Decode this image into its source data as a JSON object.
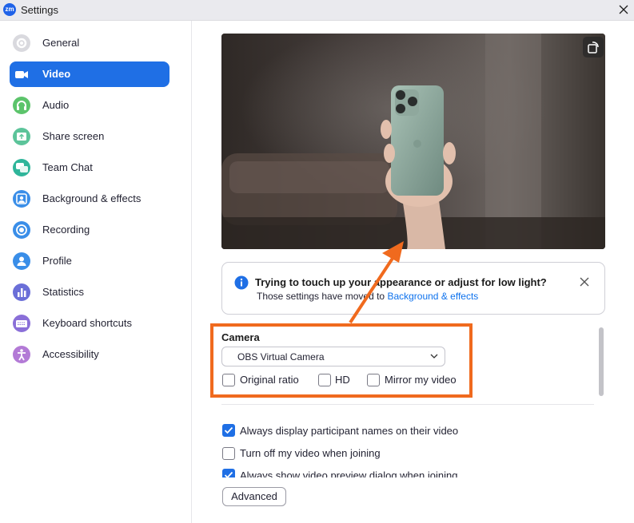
{
  "window": {
    "title": "Settings",
    "app_icon_text": "zm"
  },
  "sidebar": {
    "items": [
      {
        "label": "General",
        "icon": "gear-icon",
        "color": "#d9d9de",
        "active": false
      },
      {
        "label": "Video",
        "icon": "video-camera-icon",
        "color": "#1f6fe5",
        "active": true
      },
      {
        "label": "Audio",
        "icon": "headphones-icon",
        "color": "#5cc46b",
        "active": false
      },
      {
        "label": "Share screen",
        "icon": "share-screen-icon",
        "color": "#5cc49a",
        "active": false
      },
      {
        "label": "Team Chat",
        "icon": "chat-icon",
        "color": "#2fb59a",
        "active": false
      },
      {
        "label": "Background & effects",
        "icon": "background-effects-icon",
        "color": "#3a8ee8",
        "active": false
      },
      {
        "label": "Recording",
        "icon": "recording-icon",
        "color": "#3a8ee8",
        "active": false
      },
      {
        "label": "Profile",
        "icon": "profile-icon",
        "color": "#3a8ee8",
        "active": false
      },
      {
        "label": "Statistics",
        "icon": "statistics-icon",
        "color": "#6b6fd8",
        "active": false
      },
      {
        "label": "Keyboard shortcuts",
        "icon": "keyboard-icon",
        "color": "#8a6fd8",
        "active": false
      },
      {
        "label": "Accessibility",
        "icon": "accessibility-icon",
        "color": "#b37ad6",
        "active": false
      }
    ]
  },
  "banner": {
    "title": "Trying to touch up your appearance or adjust for low light?",
    "subtitle_prefix": "Those settings have moved to ",
    "link_text": "Background & effects"
  },
  "camera": {
    "label": "Camera",
    "selected": "OBS Virtual Camera",
    "options": [
      {
        "label": "Original ratio",
        "checked": false
      },
      {
        "label": "HD",
        "checked": false
      },
      {
        "label": "Mirror my video",
        "checked": false
      }
    ]
  },
  "video_options": [
    {
      "label": "Always display participant names on their video",
      "checked": true
    },
    {
      "label": "Turn off my video when joining",
      "checked": false
    },
    {
      "label": "Always show video preview dialog when joining",
      "checked": true
    }
  ],
  "advanced_label": "Advanced",
  "colors": {
    "accent": "#1f6fe5",
    "annotation": "#f06a1e",
    "link": "#0e72ed"
  }
}
